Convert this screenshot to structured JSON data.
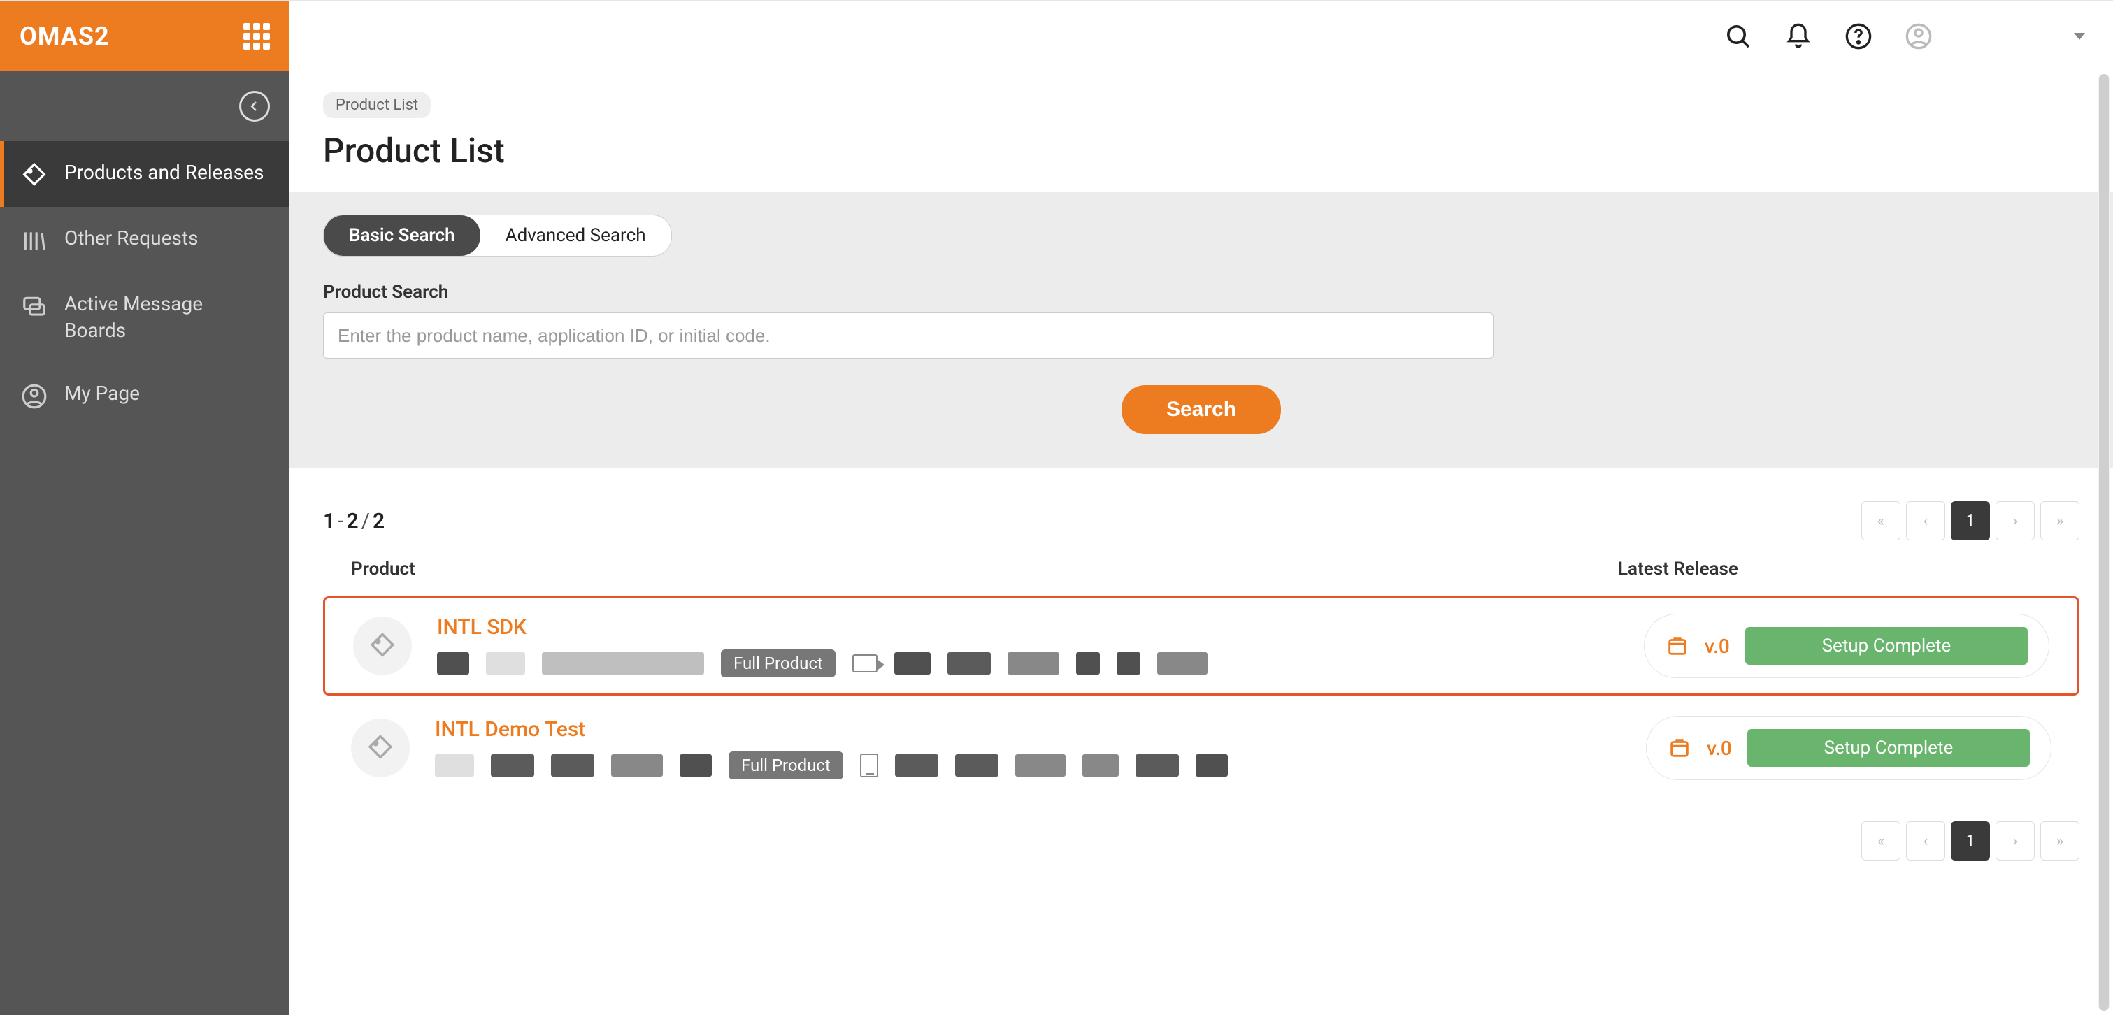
{
  "brand": {
    "name": "OMAS2"
  },
  "sidebar": {
    "items": [
      {
        "label": "Products and Releases"
      },
      {
        "label": "Other Requests"
      },
      {
        "label": "Active Message Boards"
      },
      {
        "label": "My Page"
      }
    ]
  },
  "breadcrumb": {
    "label": "Product List"
  },
  "page": {
    "title": "Product List"
  },
  "search": {
    "tabs": {
      "basic": "Basic Search",
      "advanced": "Advanced Search"
    },
    "label": "Product Search",
    "placeholder": "Enter the product name, application ID, or initial code.",
    "button": "Search"
  },
  "results": {
    "count": {
      "from": "1",
      "to": "2",
      "total": "2"
    },
    "columns": {
      "product": "Product",
      "release": "Latest Release"
    },
    "rows": [
      {
        "name": "INTL SDK",
        "badge": "Full Product",
        "version": "v.0",
        "status": "Setup Complete"
      },
      {
        "name": "INTL Demo Test",
        "badge": "Full Product",
        "version": "v.0",
        "status": "Setup Complete"
      }
    ]
  },
  "pager": {
    "page": "1"
  }
}
